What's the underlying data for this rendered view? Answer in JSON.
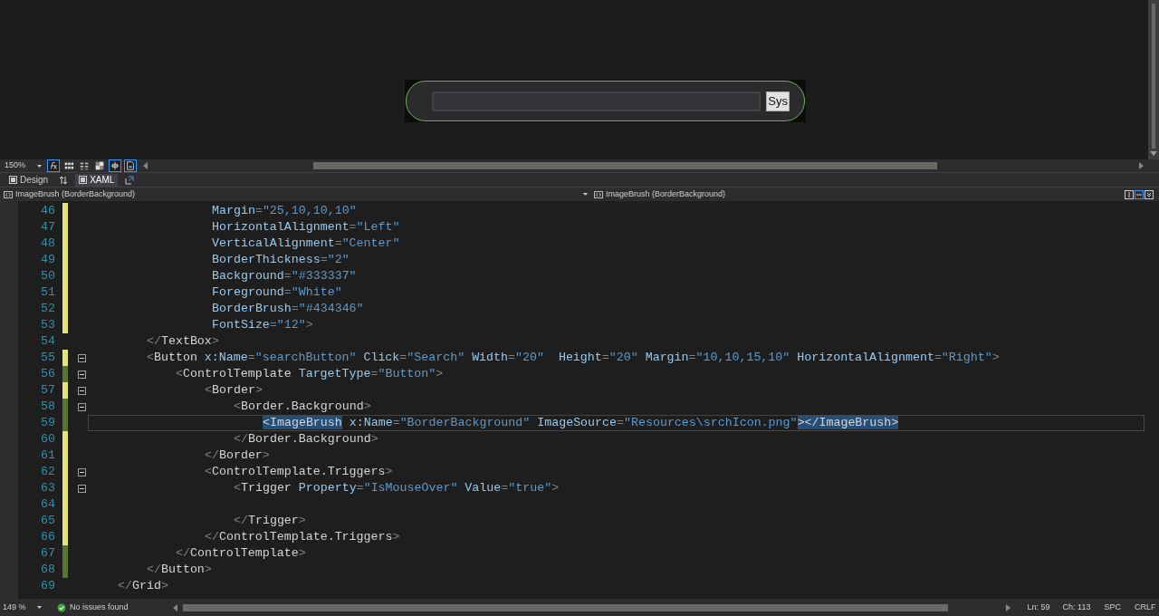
{
  "designer": {
    "search_box": {
      "button_label": "Sys"
    }
  },
  "design_toolbar": {
    "zoom": "150%",
    "tools": [
      {
        "kind": "formula",
        "on": true
      },
      {
        "kind": "grid",
        "on": false
      },
      {
        "kind": "dots",
        "on": false
      },
      {
        "kind": "checker",
        "on": false
      },
      {
        "kind": "snap",
        "on": true
      },
      {
        "kind": "page",
        "on": true
      }
    ]
  },
  "view_tabs": [
    {
      "label": "Design",
      "selected": false
    },
    {
      "label": "XAML",
      "selected": true
    }
  ],
  "breadcrumbs": [
    "ImageBrush (BorderBackground)",
    "ImageBrush (BorderBackground)"
  ],
  "editor": {
    "lines": [
      {
        "number": "46",
        "color": "#e5e57a",
        "fold": false,
        "current": false,
        "tokens": [
          {
            "kind": "attr",
            "text": "Margin"
          },
          {
            "kind": "punct",
            "text": "="
          },
          {
            "kind": "value",
            "text": "\"25,10,10,10\""
          }
        ]
      },
      {
        "number": "47",
        "color": "#e5e57a",
        "fold": false,
        "current": false,
        "tokens": [
          {
            "kind": "attr",
            "text": "HorizontalAlignment"
          },
          {
            "kind": "punct",
            "text": "="
          },
          {
            "kind": "value",
            "text": "\"Left\""
          }
        ]
      },
      {
        "number": "48",
        "color": "#e5e57a",
        "fold": false,
        "current": false,
        "tokens": [
          {
            "kind": "attr",
            "text": "VerticalAlignment"
          },
          {
            "kind": "punct",
            "text": "="
          },
          {
            "kind": "value",
            "text": "\"Center\""
          }
        ]
      },
      {
        "number": "49",
        "color": "#e5e57a",
        "fold": false,
        "current": false,
        "tokens": [
          {
            "kind": "attr",
            "text": "BorderThickness"
          },
          {
            "kind": "punct",
            "text": "="
          },
          {
            "kind": "value",
            "text": "\"2\""
          }
        ]
      },
      {
        "number": "50",
        "color": "#e5e57a",
        "fold": false,
        "current": false,
        "tokens": [
          {
            "kind": "attr",
            "text": "Background"
          },
          {
            "kind": "punct",
            "text": "="
          },
          {
            "kind": "value",
            "text": "\"#333337\""
          }
        ]
      },
      {
        "number": "51",
        "color": "#e5e57a",
        "fold": false,
        "current": false,
        "tokens": [
          {
            "kind": "attr",
            "text": "Foreground"
          },
          {
            "kind": "punct",
            "text": "="
          },
          {
            "kind": "value",
            "text": "\"White\""
          }
        ]
      },
      {
        "number": "52",
        "color": "#e5e57a",
        "fold": false,
        "current": false,
        "tokens": [
          {
            "kind": "attr",
            "text": "BorderBrush"
          },
          {
            "kind": "punct",
            "text": "="
          },
          {
            "kind": "value",
            "text": "\"#434346\""
          }
        ]
      },
      {
        "number": "53",
        "color": "#e5e57a",
        "fold": false,
        "current": false,
        "tokens": [
          {
            "kind": "attr",
            "text": "FontSize"
          },
          {
            "kind": "punct",
            "text": "="
          },
          {
            "kind": "value",
            "text": "\"12\""
          },
          {
            "kind": "punct",
            "text": ">"
          }
        ]
      },
      {
        "number": "54",
        "fold": false,
        "current": false,
        "tokens": [
          {
            "kind": "punct",
            "text": "</"
          },
          {
            "kind": "tag",
            "text": "TextBox"
          },
          {
            "kind": "punct",
            "text": ">"
          }
        ]
      },
      {
        "number": "55",
        "color": "#e5e57a",
        "fold": true,
        "current": false,
        "tokens": [
          {
            "kind": "punct",
            "text": "<"
          },
          {
            "kind": "tag",
            "text": "Button"
          },
          {
            "kind": "attr",
            "text": " x:Name"
          },
          {
            "kind": "punct",
            "text": "="
          },
          {
            "kind": "value",
            "text": "\"searchButton\""
          },
          {
            "kind": "attr",
            "text": " Click"
          },
          {
            "kind": "punct",
            "text": "="
          },
          {
            "kind": "value",
            "text": "\"Search\""
          },
          {
            "kind": "attr",
            "text": " Width"
          },
          {
            "kind": "punct",
            "text": "="
          },
          {
            "kind": "value",
            "text": "\"20\""
          },
          {
            "kind": "attr",
            "text": "  Height"
          },
          {
            "kind": "punct",
            "text": "="
          },
          {
            "kind": "value",
            "text": "\"20\""
          },
          {
            "kind": "attr",
            "text": " Margin"
          },
          {
            "kind": "punct",
            "text": "="
          },
          {
            "kind": "value",
            "text": "\"10,10,15,10\""
          },
          {
            "kind": "attr",
            "text": " HorizontalAlignment"
          },
          {
            "kind": "punct",
            "text": "="
          },
          {
            "kind": "value",
            "text": "\"Right\""
          },
          {
            "kind": "punct",
            "text": ">"
          }
        ]
      },
      {
        "number": "56",
        "color": "#577430",
        "fold": true,
        "current": false,
        "tokens": [
          {
            "kind": "punct",
            "text": "<"
          },
          {
            "kind": "tag",
            "text": "ControlTemplate"
          },
          {
            "kind": "attr",
            "text": " TargetType"
          },
          {
            "kind": "punct",
            "text": "="
          },
          {
            "kind": "value",
            "text": "\"Button\""
          },
          {
            "kind": "punct",
            "text": ">"
          }
        ]
      },
      {
        "number": "57",
        "color": "#e5e57a",
        "fold": true,
        "current": false,
        "tokens": [
          {
            "kind": "punct",
            "text": "<"
          },
          {
            "kind": "tag",
            "text": "Border"
          },
          {
            "kind": "punct",
            "text": ">"
          }
        ]
      },
      {
        "number": "58",
        "color": "#577430",
        "fold": true,
        "current": false,
        "tokens": [
          {
            "kind": "punct",
            "text": "<"
          },
          {
            "kind": "tag",
            "text": "Border.Background"
          },
          {
            "kind": "punct",
            "text": ">"
          }
        ]
      },
      {
        "number": "59",
        "color": "#577430",
        "fold": false,
        "current": true,
        "tokens": [
          {
            "kind": "match",
            "text": "<ImageBrush"
          },
          {
            "kind": "attr",
            "text": " x:Name"
          },
          {
            "kind": "punct",
            "text": "="
          },
          {
            "kind": "value",
            "text": "\"BorderBackground\""
          },
          {
            "kind": "attr",
            "text": " ImageSource"
          },
          {
            "kind": "punct",
            "text": "="
          },
          {
            "kind": "value",
            "text": "\"Resources\\srchIcon.png\""
          },
          {
            "kind": "match",
            "text": "></ImageBrush>"
          }
        ]
      },
      {
        "number": "60",
        "color": "#e5e57a",
        "fold": false,
        "current": false,
        "tokens": [
          {
            "kind": "punct",
            "text": "</"
          },
          {
            "kind": "tag",
            "text": "Border.Background"
          },
          {
            "kind": "punct",
            "text": ">"
          }
        ]
      },
      {
        "number": "61",
        "color": "#e5e57a",
        "fold": false,
        "current": false,
        "tokens": [
          {
            "kind": "punct",
            "text": "</"
          },
          {
            "kind": "tag",
            "text": "Border"
          },
          {
            "kind": "punct",
            "text": ">"
          }
        ]
      },
      {
        "number": "62",
        "color": "#e5e57a",
        "fold": true,
        "current": false,
        "tokens": [
          {
            "kind": "punct",
            "text": "<"
          },
          {
            "kind": "tag",
            "text": "ControlTemplate.Triggers"
          },
          {
            "kind": "punct",
            "text": ">"
          }
        ]
      },
      {
        "number": "63",
        "color": "#e5e57a",
        "fold": true,
        "current": false,
        "tokens": [
          {
            "kind": "punct",
            "text": "<"
          },
          {
            "kind": "tag",
            "text": "Trigger"
          },
          {
            "kind": "attr",
            "text": " Property"
          },
          {
            "kind": "punct",
            "text": "="
          },
          {
            "kind": "value",
            "text": "\"IsMouseOver\""
          },
          {
            "kind": "attr",
            "text": " Value"
          },
          {
            "kind": "punct",
            "text": "="
          },
          {
            "kind": "value",
            "text": "\"true\""
          },
          {
            "kind": "punct",
            "text": ">"
          }
        ]
      },
      {
        "number": "64",
        "color": "#e5e57a",
        "fold": false,
        "current": false
      },
      {
        "number": "65",
        "color": "#e5e57a",
        "fold": false,
        "current": false,
        "tokens": [
          {
            "kind": "punct",
            "text": "</"
          },
          {
            "kind": "tag",
            "text": "Trigger"
          },
          {
            "kind": "punct",
            "text": ">"
          }
        ]
      },
      {
        "number": "66",
        "color": "#e5e57a",
        "fold": false,
        "current": false,
        "tokens": [
          {
            "kind": "punct",
            "text": "</"
          },
          {
            "kind": "tag",
            "text": "ControlTemplate.Triggers"
          },
          {
            "kind": "punct",
            "text": ">"
          }
        ]
      },
      {
        "number": "67",
        "color": "#577430",
        "fold": false,
        "current": false,
        "tokens": [
          {
            "kind": "punct",
            "text": "</"
          },
          {
            "kind": "tag",
            "text": "ControlTemplate"
          },
          {
            "kind": "punct",
            "text": ">"
          }
        ]
      },
      {
        "number": "68",
        "color": "#577430",
        "fold": false,
        "current": false,
        "tokens": [
          {
            "kind": "punct",
            "text": "</"
          },
          {
            "kind": "tag",
            "text": "Button"
          },
          {
            "kind": "punct",
            "text": ">"
          }
        ]
      },
      {
        "number": "69",
        "fold": false,
        "current": false,
        "tokens": [
          {
            "kind": "punct",
            "text": "</"
          },
          {
            "kind": "tag",
            "text": "Grid"
          },
          {
            "kind": "punct",
            "text": ">"
          }
        ]
      }
    ]
  },
  "status_bar": {
    "zoom": "149 %",
    "issues": "No issues found",
    "line": "Ln: 59",
    "column": "Ch: 113",
    "indent_mode": "SPC",
    "line_ending": "CRLF"
  }
}
